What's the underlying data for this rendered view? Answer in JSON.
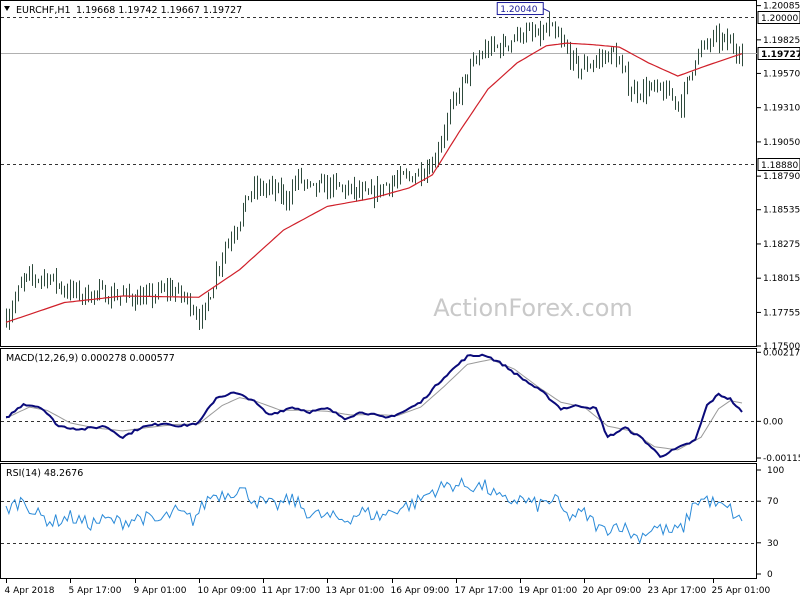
{
  "header": {
    "title": "EURCHF,H1",
    "ohlc": "1.19668 1.19742 1.19667 1.19727",
    "collapse_icon": "triangle-down-icon"
  },
  "watermark": "ActionForex.com",
  "colors": {
    "candle": "#2e4a3c",
    "ma": "#d0202a",
    "macd_line": "#0a0a7a",
    "signal_line": "#9a9a9a",
    "rsi": "#2a8ad8",
    "level": "#333333",
    "grid": "#666666"
  },
  "chart_data": [
    {
      "type": "candlestick",
      "name": "price",
      "ylim": [
        1.175,
        1.2012
      ],
      "yticks": [
        "1.20085",
        "1.19825",
        "1.19570",
        "1.19310",
        "1.19050",
        "1.18790",
        "1.18535",
        "1.18275",
        "1.18015",
        "1.17755",
        "1.17500"
      ],
      "levels": [
        {
          "value": 1.2,
          "label": "1.20000"
        },
        {
          "value": 1.1888,
          "label": "1.18880"
        }
      ],
      "current_price": {
        "value": 1.19727,
        "label": "1.19727"
      },
      "annotation": {
        "text": "1.20040",
        "value": 1.2004
      },
      "ma_period_hint": "moving average (red)",
      "close_waypoints": [
        [
          0,
          1.1772
        ],
        [
          6,
          1.18
        ],
        [
          14,
          1.1803
        ],
        [
          20,
          1.1793
        ],
        [
          26,
          1.1789
        ],
        [
          32,
          1.179
        ],
        [
          40,
          1.1788
        ],
        [
          48,
          1.1786
        ],
        [
          56,
          1.1794
        ],
        [
          62,
          1.1785
        ],
        [
          67,
          1.177
        ],
        [
          74,
          1.1821
        ],
        [
          80,
          1.1848
        ],
        [
          84,
          1.1868
        ],
        [
          90,
          1.187
        ],
        [
          96,
          1.1862
        ],
        [
          100,
          1.1878
        ],
        [
          104,
          1.1868
        ],
        [
          110,
          1.1872
        ],
        [
          118,
          1.1868
        ],
        [
          124,
          1.1863
        ],
        [
          130,
          1.1873
        ],
        [
          138,
          1.1878
        ],
        [
          146,
          1.1889
        ],
        [
          152,
          1.1928
        ],
        [
          158,
          1.1957
        ],
        [
          164,
          1.1975
        ],
        [
          170,
          1.1978
        ],
        [
          176,
          1.1988
        ],
        [
          182,
          1.1985
        ],
        [
          186,
          1.199
        ],
        [
          190,
          1.198
        ],
        [
          196,
          1.196
        ],
        [
          202,
          1.1967
        ],
        [
          208,
          1.1973
        ],
        [
          214,
          1.1944
        ],
        [
          220,
          1.1945
        ],
        [
          226,
          1.1942
        ],
        [
          231,
          1.1934
        ],
        [
          236,
          1.197
        ],
        [
          242,
          1.1983
        ],
        [
          248,
          1.198
        ],
        [
          252,
          1.1973
        ]
      ],
      "ma_waypoints": [
        [
          0,
          1.1768
        ],
        [
          20,
          1.1783
        ],
        [
          40,
          1.1788
        ],
        [
          66,
          1.1787
        ],
        [
          80,
          1.1808
        ],
        [
          95,
          1.1838
        ],
        [
          110,
          1.1856
        ],
        [
          125,
          1.1862
        ],
        [
          138,
          1.187
        ],
        [
          146,
          1.188
        ],
        [
          155,
          1.1912
        ],
        [
          165,
          1.1945
        ],
        [
          175,
          1.1965
        ],
        [
          185,
          1.1978
        ],
        [
          192,
          1.198
        ],
        [
          200,
          1.1979
        ],
        [
          210,
          1.1977
        ],
        [
          220,
          1.1965
        ],
        [
          230,
          1.1955
        ],
        [
          240,
          1.1963
        ],
        [
          252,
          1.1972
        ]
      ]
    },
    {
      "type": "line",
      "name": "MACD",
      "label": "MACD(12,26,9) 0.000278 0.000577",
      "ylim": [
        -0.00125,
        0.00225
      ],
      "yticks": [
        "0.002178",
        "0.00",
        "-0.001156"
      ],
      "yticks_values": [
        0.002178,
        0.0,
        -0.001156
      ],
      "zero_line": 0.0,
      "macd_waypoints": [
        [
          0,
          0.0001
        ],
        [
          6,
          0.00055
        ],
        [
          12,
          0.00045
        ],
        [
          18,
          -0.00015
        ],
        [
          26,
          -0.00025
        ],
        [
          34,
          -0.00015
        ],
        [
          40,
          -0.0005
        ],
        [
          46,
          -0.0002
        ],
        [
          54,
          -5e-05
        ],
        [
          60,
          -0.00015
        ],
        [
          66,
          -5e-05
        ],
        [
          72,
          0.00075
        ],
        [
          78,
          0.0009
        ],
        [
          84,
          0.0007
        ],
        [
          90,
          0.0002
        ],
        [
          98,
          0.00045
        ],
        [
          104,
          0.0003
        ],
        [
          110,
          0.0004
        ],
        [
          116,
          0.0001
        ],
        [
          122,
          0.0003
        ],
        [
          130,
          0.0001
        ],
        [
          136,
          0.0003
        ],
        [
          142,
          0.0006
        ],
        [
          150,
          0.0014
        ],
        [
          158,
          0.00205
        ],
        [
          164,
          0.0021
        ],
        [
          170,
          0.0018
        ],
        [
          176,
          0.0014
        ],
        [
          184,
          0.0009
        ],
        [
          190,
          0.0004
        ],
        [
          196,
          0.0005
        ],
        [
          202,
          0.0004
        ],
        [
          206,
          -0.0005
        ],
        [
          212,
          -0.0002
        ],
        [
          218,
          -0.00055
        ],
        [
          224,
          -0.0011
        ],
        [
          230,
          -0.00085
        ],
        [
          236,
          -0.0006
        ],
        [
          240,
          0.0005
        ],
        [
          244,
          0.00085
        ],
        [
          248,
          0.0007
        ],
        [
          252,
          0.00028
        ]
      ],
      "signal_waypoints": [
        [
          0,
          0.0001
        ],
        [
          8,
          0.00045
        ],
        [
          14,
          0.00035
        ],
        [
          22,
          -5e-05
        ],
        [
          30,
          -0.0002
        ],
        [
          40,
          -0.0003
        ],
        [
          48,
          -0.0002
        ],
        [
          58,
          -0.0001
        ],
        [
          66,
          -8e-05
        ],
        [
          74,
          0.0005
        ],
        [
          80,
          0.00075
        ],
        [
          86,
          0.00062
        ],
        [
          94,
          0.00035
        ],
        [
          102,
          0.00035
        ],
        [
          110,
          0.00032
        ],
        [
          118,
          0.0002
        ],
        [
          126,
          0.00022
        ],
        [
          134,
          0.00018
        ],
        [
          142,
          0.00045
        ],
        [
          150,
          0.0011
        ],
        [
          158,
          0.0018
        ],
        [
          166,
          0.00195
        ],
        [
          174,
          0.00165
        ],
        [
          182,
          0.0011
        ],
        [
          190,
          0.0006
        ],
        [
          198,
          0.00045
        ],
        [
          206,
          -0.00015
        ],
        [
          214,
          -0.0003
        ],
        [
          222,
          -0.0008
        ],
        [
          230,
          -0.0009
        ],
        [
          238,
          -0.0005
        ],
        [
          244,
          0.0004
        ],
        [
          248,
          0.00065
        ],
        [
          252,
          0.00058
        ]
      ]
    },
    {
      "type": "line",
      "name": "RSI",
      "label": "RSI(14) 48.2676",
      "ylim": [
        0,
        100
      ],
      "yticks": [
        "100",
        "70",
        "30",
        "0"
      ],
      "yticks_values": [
        100,
        70,
        30,
        0
      ],
      "levels": [
        70,
        30
      ],
      "rsi_waypoints": [
        [
          0,
          62
        ],
        [
          6,
          72
        ],
        [
          10,
          58
        ],
        [
          16,
          50
        ],
        [
          22,
          55
        ],
        [
          28,
          48
        ],
        [
          34,
          52
        ],
        [
          40,
          50
        ],
        [
          46,
          55
        ],
        [
          52,
          50
        ],
        [
          58,
          60
        ],
        [
          64,
          52
        ],
        [
          70,
          75
        ],
        [
          76,
          78
        ],
        [
          80,
          82
        ],
        [
          86,
          70
        ],
        [
          92,
          65
        ],
        [
          98,
          72
        ],
        [
          104,
          58
        ],
        [
          110,
          55
        ],
        [
          116,
          52
        ],
        [
          122,
          60
        ],
        [
          128,
          55
        ],
        [
          134,
          63
        ],
        [
          140,
          68
        ],
        [
          146,
          80
        ],
        [
          152,
          86
        ],
        [
          158,
          85
        ],
        [
          164,
          84
        ],
        [
          170,
          70
        ],
        [
          176,
          72
        ],
        [
          182,
          66
        ],
        [
          188,
          72
        ],
        [
          192,
          55
        ],
        [
          198,
          58
        ],
        [
          204,
          42
        ],
        [
          210,
          48
        ],
        [
          216,
          35
        ],
        [
          222,
          45
        ],
        [
          228,
          40
        ],
        [
          232,
          45
        ],
        [
          236,
          70
        ],
        [
          240,
          72
        ],
        [
          244,
          65
        ],
        [
          248,
          62
        ],
        [
          252,
          48
        ]
      ]
    }
  ],
  "x_axis": {
    "count": 253,
    "labels": [
      {
        "i": 0,
        "text": "4 Apr 2018"
      },
      {
        "i": 22,
        "text": "5 Apr 17:00"
      },
      {
        "i": 44,
        "text": "9 Apr 01:00"
      },
      {
        "i": 66,
        "text": "10 Apr 09:00"
      },
      {
        "i": 88,
        "text": "11 Apr 17:00"
      },
      {
        "i": 110,
        "text": "13 Apr 01:00"
      },
      {
        "i": 132,
        "text": "16 Apr 09:00"
      },
      {
        "i": 154,
        "text": "17 Apr 17:00"
      },
      {
        "i": 176,
        "text": "19 Apr 01:00"
      },
      {
        "i": 198,
        "text": "20 Apr 09:00"
      },
      {
        "i": 220,
        "text": "23 Apr 17:00"
      },
      {
        "i": 242,
        "text": "25 Apr 01:00"
      }
    ]
  }
}
